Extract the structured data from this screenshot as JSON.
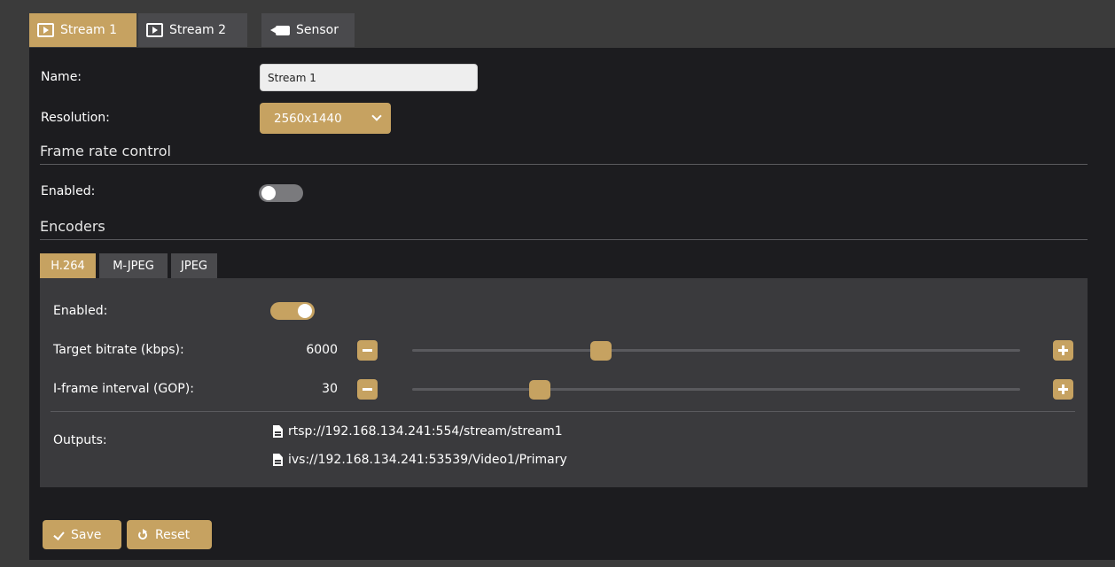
{
  "tabs": [
    {
      "label": "Stream 1",
      "icon": "play-icon",
      "active": true
    },
    {
      "label": "Stream 2",
      "icon": "play-icon",
      "active": false
    },
    {
      "label": "Sensor",
      "icon": "video-camera-icon",
      "active": false
    }
  ],
  "form": {
    "name_label": "Name:",
    "name_value": "Stream 1",
    "resolution_label": "Resolution:",
    "resolution_value": "2560x1440"
  },
  "frame_rate": {
    "title": "Frame rate control",
    "enabled_label": "Enabled:",
    "enabled": false
  },
  "encoders": {
    "title": "Encoders",
    "tabs": [
      {
        "label": "H.264",
        "active": true
      },
      {
        "label": "M-JPEG",
        "active": false
      },
      {
        "label": "JPEG",
        "active": false
      }
    ],
    "enabled_label": "Enabled:",
    "enabled": true,
    "bitrate": {
      "label": "Target bitrate (kbps):",
      "value": "6000",
      "fraction": 0.31
    },
    "gop": {
      "label": "I-frame interval (GOP):",
      "value": "30",
      "fraction": 0.21
    },
    "outputs_label": "Outputs:",
    "outputs": [
      "rtsp://192.168.134.241:554/stream/stream1",
      "ivs://192.168.134.241:53539/Video1/Primary"
    ]
  },
  "actions": {
    "save_label": "Save",
    "reset_label": "Reset"
  },
  "colors": {
    "accent": "#c6a261",
    "background": "#1c1c1f",
    "panel": "#3a3a3d"
  }
}
